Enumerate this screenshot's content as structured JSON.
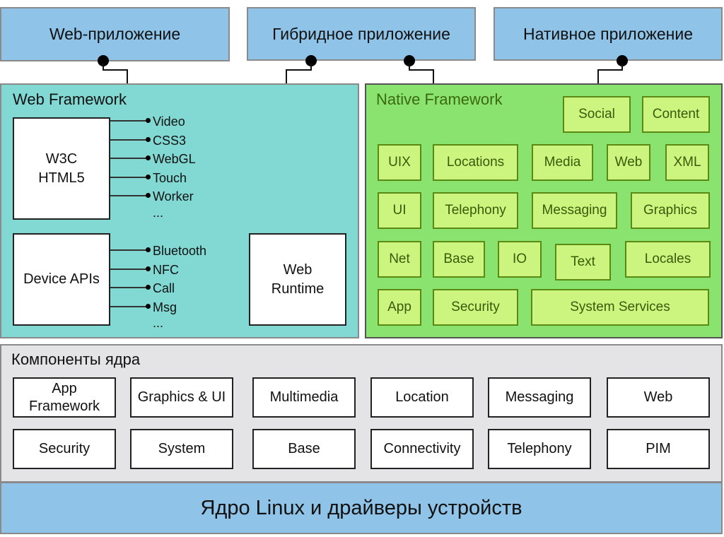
{
  "apps": [
    {
      "label": "Web-приложение"
    },
    {
      "label": "Гибридное приложение"
    },
    {
      "label": "Нативное приложение"
    }
  ],
  "web_framework": {
    "title": "Web Framework",
    "w3c": {
      "line1": "W3C",
      "line2": "HTML5"
    },
    "w3c_features": [
      "Video",
      "CSS3",
      "WebGL",
      "Touch",
      "Worker",
      "..."
    ],
    "device_apis": {
      "label": "Device APIs"
    },
    "device_features": [
      "Bluetooth",
      "NFC",
      "Call",
      "Msg",
      "..."
    ],
    "runtime": {
      "line1": "Web",
      "line2": "Runtime"
    }
  },
  "native_framework": {
    "title": "Native Framework",
    "modules": [
      "Social",
      "Content",
      "UIX",
      "Locations",
      "Media",
      "Web",
      "XML",
      "UI",
      "Telephony",
      "Messaging",
      "Graphics",
      "Net",
      "Base",
      "IO",
      "Text",
      "Locales",
      "App",
      "Security",
      "System Services"
    ]
  },
  "core": {
    "title": "Компоненты ядра",
    "row1": [
      {
        "line1": "App",
        "line2": "Framework"
      },
      {
        "line1": "Graphics & UI"
      },
      {
        "line1": "Multimedia"
      },
      {
        "line1": "Location"
      },
      {
        "line1": "Messaging"
      },
      {
        "line1": "Web"
      }
    ],
    "row2": [
      "Security",
      "System",
      "Base",
      "Connectivity",
      "Telephony",
      "PIM"
    ]
  },
  "kernel": {
    "label": "Ядро Linux и драйверы устройств"
  },
  "colors": {
    "app_blue": "#8fc3e8",
    "web_framework_teal": "#82d9d4",
    "native_framework_green": "#8be36f",
    "native_module": "#ccf57f",
    "core_gray": "#e4e4e6"
  }
}
